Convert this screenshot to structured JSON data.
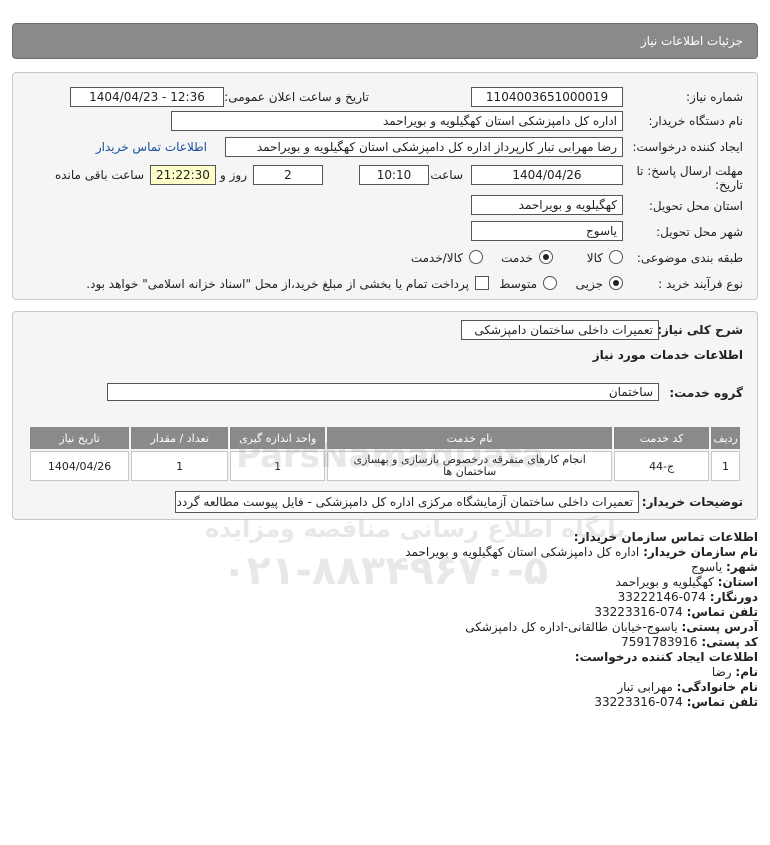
{
  "header": {
    "title": "جزئیات اطلاعات نیاز"
  },
  "details": {
    "need_number_label": "شماره نیاز:",
    "need_number": "1104003651000019",
    "announce_label": "تاریخ و ساعت اعلان عمومی:",
    "announce_value": "1404/04/23 - 12:36",
    "buyer_label": "نام دستگاه خریدار:",
    "buyer_value": "اداره کل دامپزشکی استان کهگیلویه و بویراحمد",
    "creator_label": "ایجاد کننده درخواست:",
    "creator_value": "رضا مهرابی تبار کارپرداز اداره کل دامپزشکی استان کهگیلویه و بویراحمد",
    "contact_link": "اطلاعات تماس خریدار",
    "deadline_label": "مهلت ارسال پاسخ: تا",
    "deadline_label2": "تاریخ:",
    "deadline_date": "1404/04/26",
    "hour_label": "ساعت",
    "deadline_time": "10:10",
    "days_value": "2",
    "days_label": "روز و",
    "remaining_time": "21:22:30",
    "remaining_label": "ساعت باقی مانده",
    "province_label": "استان محل تحویل:",
    "province_value": "کهگیلویه و بویراحمد",
    "city_label": "شهر محل تحویل:",
    "city_value": "یاسوج",
    "category_label": "طبقه بندی موضوعی:",
    "category_options": [
      "کالا",
      "خدمت",
      "کالا/خدمت"
    ],
    "category_selected": 1,
    "process_label": "نوع فرآیند خرید :",
    "process_options": [
      "جزیی",
      "متوسط"
    ],
    "process_selected": 0,
    "treasury_note": "پرداخت تمام یا بخشی از مبلغ خرید،از محل \"اسناد خزانه اسلامی\" خواهد بود."
  },
  "need": {
    "summary_label": "شرح کلی نیاز:",
    "summary_value": "تعمیرات داخلی ساختمان دامپزشکی",
    "services_heading": "اطلاعات خدمات مورد نیاز",
    "service_group_label": "گروه خدمت:",
    "service_group_value": "ساختمان",
    "table": {
      "headers": [
        "ردیف",
        "کد خدمت",
        "نام خدمت",
        "واحد اندازه گیری",
        "تعداد / مقدار",
        "تاریخ نیاز"
      ],
      "rows": [
        [
          "1",
          "ج-44",
          "انجام کارهای متفرقه درخصوص بازسازی و بهسازی ساختمان ها",
          "1",
          "1",
          "1404/04/26"
        ]
      ]
    },
    "buyer_notes_label": "توضیحات خریدار:",
    "buyer_notes_value": "تعمیرات داخلی ساختمان آزمایشگاه مرکزی اداره کل دامپزشکی - فایل پیوست مطالعه گردد"
  },
  "contact": {
    "heading": "اطلاعات تماس سازمان خریدار:",
    "org_label": "نام سازمان خریدار:",
    "org_value": "اداره کل دامپزشکی استان کهگیلویه و بویراحمد",
    "city_label": "شهر:",
    "city_value": "یاسوج",
    "province_label": "استان:",
    "province_value": "کهگیلویه و بویراحمد",
    "fax_label": "دورنگار:",
    "fax_value": "074-33222146",
    "phone_label": "تلفن تماس:",
    "phone_value": "074-33223316",
    "address_label": "آدرس پستی:",
    "address_value": "یاسوج-خیابان طالقانی-اداره کل دامپزشکی",
    "postal_label": "کد پستی:",
    "postal_value": "7591783916",
    "creator_heading": "اطلاعات ایجاد کننده درخواست:",
    "name_label": "نام:",
    "name_value": "رضا",
    "family_label": "نام خانوادگی:",
    "family_value": "مهرابی تبار",
    "creator_phone_label": "تلفن تماس:",
    "creator_phone_value": "074-33223316"
  },
  "watermark": {
    "brand": "ParsNamadData",
    "slogan": "پایگاه اطلاع رسانی مناقصه ومزایده",
    "phone": "۰۲۱-۸۸۳۴۹۶۷۰-۵"
  }
}
